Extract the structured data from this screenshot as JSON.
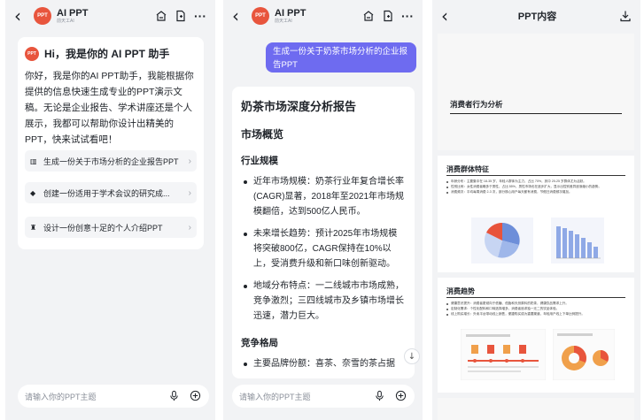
{
  "screen1": {
    "header": {
      "app_name": "AI PPT",
      "subtitle": "前天工AI",
      "logo_text": "PPT"
    },
    "greeting": "Hi，我是你的 AI PPT 助手",
    "intro": "你好，我是你的AI PPT助手，我能根据你提供的信息快速生成专业的PPT演示文稿。无论是企业报告、学术讲座还是个人展示，我都可以帮助你设计出精美的PPT，快来试试看吧！",
    "suggestions": [
      {
        "icon": "chart-icon",
        "glyph": "▥",
        "label": "生成一份关于市场分析的企业报告PPT"
      },
      {
        "icon": "book-icon",
        "glyph": "◆",
        "label": "创建一份适用于学术会议的研究成..."
      },
      {
        "icon": "person-icon",
        "glyph": "♜",
        "label": "设计一份创意十足的个人介绍PPT"
      }
    ],
    "input_placeholder": "请输入你的PPT主题"
  },
  "screen2": {
    "header": {
      "app_name": "AI PPT",
      "subtitle": "前天工AI",
      "logo_text": "PPT"
    },
    "user_message": "生成一份关于奶茶市场分析的企业报告PPT",
    "doc": {
      "title": "奶茶市场深度分析报告",
      "section1": "市场概览",
      "sub1": "行业规模",
      "bullets1": [
        "近年市场规模：奶茶行业年复合增长率(CAGR)显著，2018年至2021年市场规模翻倍，达到500亿人民币。",
        "未来增长趋势：预计2025年市场规模将突破800亿，CAGR保持在10%以上，受消费升级和新口味创新驱动。",
        "地域分布特点：一二线城市市场成熟，竞争激烈；三四线城市及乡镇市场增长迅速，潜力巨大。"
      ],
      "sub2": "竞争格局",
      "bullets2": [
        "主要品牌份额：喜茶、奈雪的茶占据"
      ]
    },
    "input_placeholder": "请输入你的PPT主题"
  },
  "screen3": {
    "title": "PPT内容",
    "slide1_title": "消费者行为分析",
    "slide2": {
      "title": "消费群体特征",
      "bullets": [
        "年龄分布：主要集中在 18-35 岁，年轻人群体为主力，占比 70%，其中 20-25 岁群体尤为活跃。",
        "性别比例：女性消费者略多于男性，占比 55%，男性市场也在逐步扩大，显示出性别差异逐渐缩小的趋势。",
        "消费频次：平均每周消费 2-3 次，部分核心用户每天都有消费，节假日消费频次增加。"
      ]
    },
    "slide3": {
      "title": "消费趋势",
      "bullets": [
        "健康意识提升：消费者更倾向于低糖、低脂和天然原料的奶茶，健康饮品需求上升。",
        "定制化需求：个性化配料和口味选择增多，消费者追求独一无二的饮品体验。",
        "线上购买增长：外卖平台带动线上销售，便捷购买成为重要渠道，年轻用户线上下单比例提升。"
      ]
    },
    "colors": {
      "pie1": "#6d8ed9",
      "pie2": "#9fb7ea",
      "pie3": "#c7d5f3",
      "pie4": "#e8533b",
      "bars": "#8fa9e6",
      "accent": "#e8553d",
      "orange": "#f0a04b"
    }
  },
  "colors": {
    "brand": "#e8553d",
    "bubble": "#6e6bf0",
    "bg": "#f2f3f5"
  }
}
